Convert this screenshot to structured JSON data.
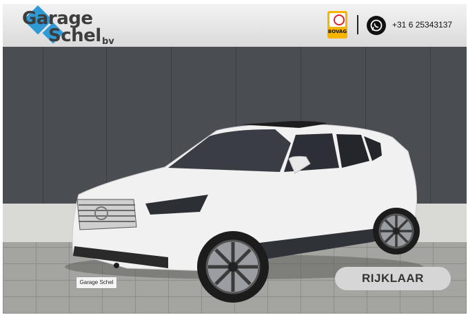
{
  "header": {
    "logo_line1": "Garage",
    "logo_line2": "Schel",
    "logo_suffix": "bv",
    "bovag_label": "BOVAG",
    "phone": "+31 6 25343137"
  },
  "vehicle": {
    "plate_text": "Garage Schel",
    "badge_label": "RIJKLAAR"
  },
  "colors": {
    "brand_blue": "#2f9ad6",
    "bovag_yellow": "#f7b500",
    "whatsapp_bg": "#111111"
  },
  "icons": [
    "bovag-logo-icon",
    "whatsapp-icon"
  ]
}
